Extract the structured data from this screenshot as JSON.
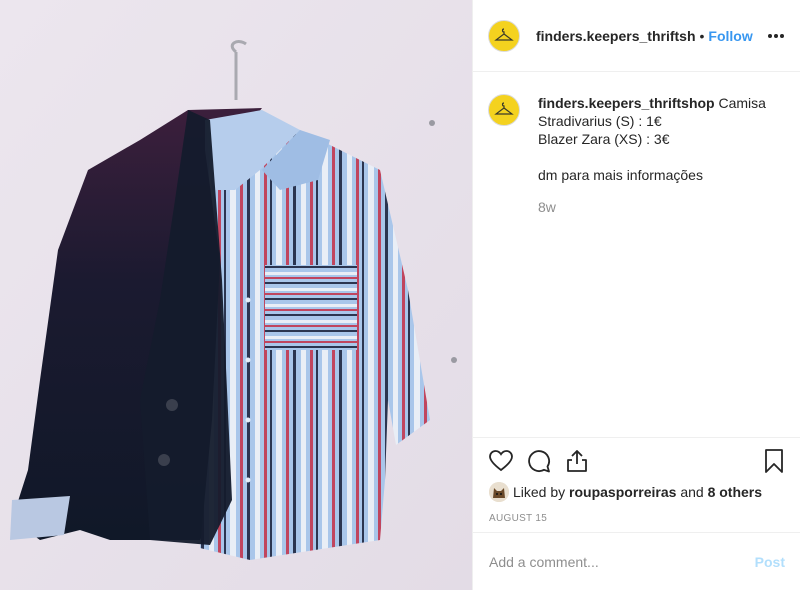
{
  "post": {
    "photo_alt": "",
    "header": {
      "username": "finders.keepers_thriftsh",
      "separator": "•",
      "follow_label": "Follow"
    },
    "caption": {
      "username": "finders.keepers_thriftshop",
      "first_line": "Camisa",
      "lines": [
        "Stradivarius (S) : 1€",
        "Blazer Zara (XS) : 3€"
      ],
      "footer_line": "dm para mais informações",
      "age": "8w"
    },
    "likes": {
      "prefix": "Liked by",
      "user": "roupasporreiras",
      "conjunction": "and",
      "others": "8 others"
    },
    "date": "AUGUST 15",
    "comment": {
      "placeholder": "Add a comment...",
      "post_label": "Post"
    },
    "colors": {
      "accent": "#3897f0",
      "post_disabled": "#b2dffc",
      "text": "#262626",
      "muted": "#8e8e8e"
    },
    "icons": [
      "heart-icon",
      "comment-icon",
      "share-icon",
      "bookmark-icon",
      "more-icon"
    ]
  }
}
